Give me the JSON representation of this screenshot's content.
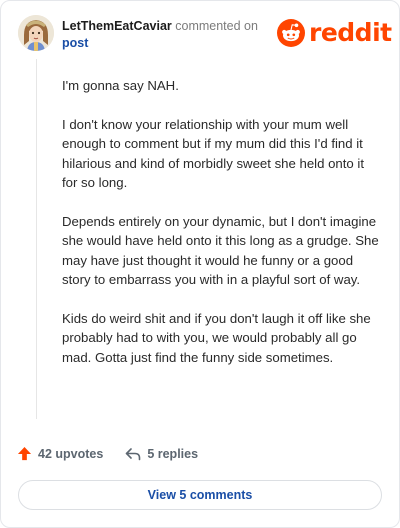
{
  "comment": {
    "username": "LetThemEatCaviar",
    "action": "commented on",
    "post_link": "post",
    "paragraphs": [
      "I'm gonna say NAH.",
      "I don't know your relationship with your mum well enough to comment but if my mum did this I'd find it hilarious and kind of morbidly sweet she held onto it for so long.",
      "Depends entirely on your dynamic, but I don't imagine she would have held onto it this long as a grudge. She may have just thought it would he funny or a good story to embarrass you with in a playful sort of way.",
      "Kids do weird shit and if you don't laugh it off like she probably had to with you, we would probably all go mad. Gotta just find the funny side sometimes."
    ]
  },
  "brand": {
    "name": "reddit",
    "color": "#ff4500"
  },
  "footer": {
    "upvotes_label": "42 upvotes",
    "replies_label": "5 replies",
    "view_comments_label": "View 5 comments"
  },
  "icons": {
    "upvote": "upvote-arrow-icon",
    "reply": "reply-arrow-icon",
    "logo": "reddit-snoo-icon"
  }
}
